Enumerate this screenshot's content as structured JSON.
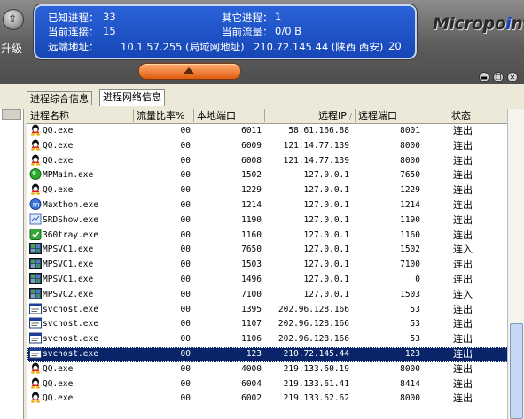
{
  "header": {
    "upgrade_label": "升级",
    "known_processes_label": "已知进程：",
    "known_processes_value": "33",
    "other_processes_label": "其它进程：",
    "other_processes_value": "1",
    "current_connections_label": "当前连接：",
    "current_connections_value": "15",
    "current_traffic_label": "当前流量：",
    "current_traffic_value": "0/0 B",
    "remote_address_label": "远端地址：",
    "remote_local_ip": "10.1.57.255 (局域网地址)",
    "remote_ip_location": "210.72.145.44 (陕西 西安)",
    "remote_count": "20",
    "logo_prefix": "Micropo",
    "logo_mid": "i",
    "logo_suffix": "nt"
  },
  "tabs": [
    {
      "label": "进程综合信息",
      "active": false
    },
    {
      "label": "进程网络信息",
      "active": true
    }
  ],
  "table": {
    "columns": [
      "进程名称",
      "流量比率%",
      "本地端口",
      "远程IP",
      "远程端口",
      "状态"
    ],
    "sorted_column_mark": "/",
    "rows": [
      {
        "icon": "qq",
        "name": "QQ.exe",
        "rate": "00",
        "lport": "6011",
        "rip": "58.61.166.88",
        "rport": "8001",
        "state": "连出"
      },
      {
        "icon": "qq",
        "name": "QQ.exe",
        "rate": "00",
        "lport": "6009",
        "rip": "121.14.77.139",
        "rport": "8000",
        "state": "连出"
      },
      {
        "icon": "qq",
        "name": "QQ.exe",
        "rate": "00",
        "lport": "6008",
        "rip": "121.14.77.139",
        "rport": "8000",
        "state": "连出"
      },
      {
        "icon": "mpmain",
        "name": "MPMain.exe",
        "rate": "00",
        "lport": "1502",
        "rip": "127.0.0.1",
        "rport": "7650",
        "state": "连出"
      },
      {
        "icon": "qq",
        "name": "QQ.exe",
        "rate": "00",
        "lport": "1229",
        "rip": "127.0.0.1",
        "rport": "1229",
        "state": "连出"
      },
      {
        "icon": "maxthon",
        "name": "Maxthon.exe",
        "rate": "00",
        "lport": "1214",
        "rip": "127.0.0.1",
        "rport": "1214",
        "state": "连出"
      },
      {
        "icon": "srd",
        "name": "SRDShow.exe",
        "rate": "00",
        "lport": "1190",
        "rip": "127.0.0.1",
        "rport": "1190",
        "state": "连出"
      },
      {
        "icon": "tray360",
        "name": "360tray.exe",
        "rate": "00",
        "lport": "1160",
        "rip": "127.0.0.1",
        "rport": "1160",
        "state": "连出"
      },
      {
        "icon": "mpsvc",
        "name": "MPSVC1.exe",
        "rate": "00",
        "lport": "7650",
        "rip": "127.0.0.1",
        "rport": "1502",
        "state": "连入"
      },
      {
        "icon": "mpsvc",
        "name": "MPSVC1.exe",
        "rate": "00",
        "lport": "1503",
        "rip": "127.0.0.1",
        "rport": "7100",
        "state": "连出"
      },
      {
        "icon": "mpsvc",
        "name": "MPSVC1.exe",
        "rate": "00",
        "lport": "1496",
        "rip": "127.0.0.1",
        "rport": "0",
        "state": "连出"
      },
      {
        "icon": "mpsvc",
        "name": "MPSVC2.exe",
        "rate": "00",
        "lport": "7100",
        "rip": "127.0.0.1",
        "rport": "1503",
        "state": "连入"
      },
      {
        "icon": "svchost",
        "name": "svchost.exe",
        "rate": "00",
        "lport": "1395",
        "rip": "202.96.128.166",
        "rport": "53",
        "state": "连出"
      },
      {
        "icon": "svchost",
        "name": "svchost.exe",
        "rate": "00",
        "lport": "1107",
        "rip": "202.96.128.166",
        "rport": "53",
        "state": "连出"
      },
      {
        "icon": "svchost",
        "name": "svchost.exe",
        "rate": "00",
        "lport": "1106",
        "rip": "202.96.128.166",
        "rport": "53",
        "state": "连出"
      },
      {
        "icon": "svchost",
        "name": "svchost.exe",
        "rate": "00",
        "lport": "123",
        "rip": "210.72.145.44",
        "rport": "123",
        "state": "连出",
        "selected": true
      },
      {
        "icon": "qq",
        "name": "QQ.exe",
        "rate": "00",
        "lport": "4000",
        "rip": "219.133.60.19",
        "rport": "8000",
        "state": "连出"
      },
      {
        "icon": "qq",
        "name": "QQ.exe",
        "rate": "00",
        "lport": "6004",
        "rip": "219.133.61.41",
        "rport": "8414",
        "state": "连出"
      },
      {
        "icon": "qq",
        "name": "QQ.exe",
        "rate": "00",
        "lport": "6002",
        "rip": "219.133.62.62",
        "rport": "8000",
        "state": "连出"
      }
    ]
  },
  "colors": {
    "info_panel": "#1a50c4",
    "selected_row": "#0a246a",
    "toggle_button": "#f07a2a"
  }
}
